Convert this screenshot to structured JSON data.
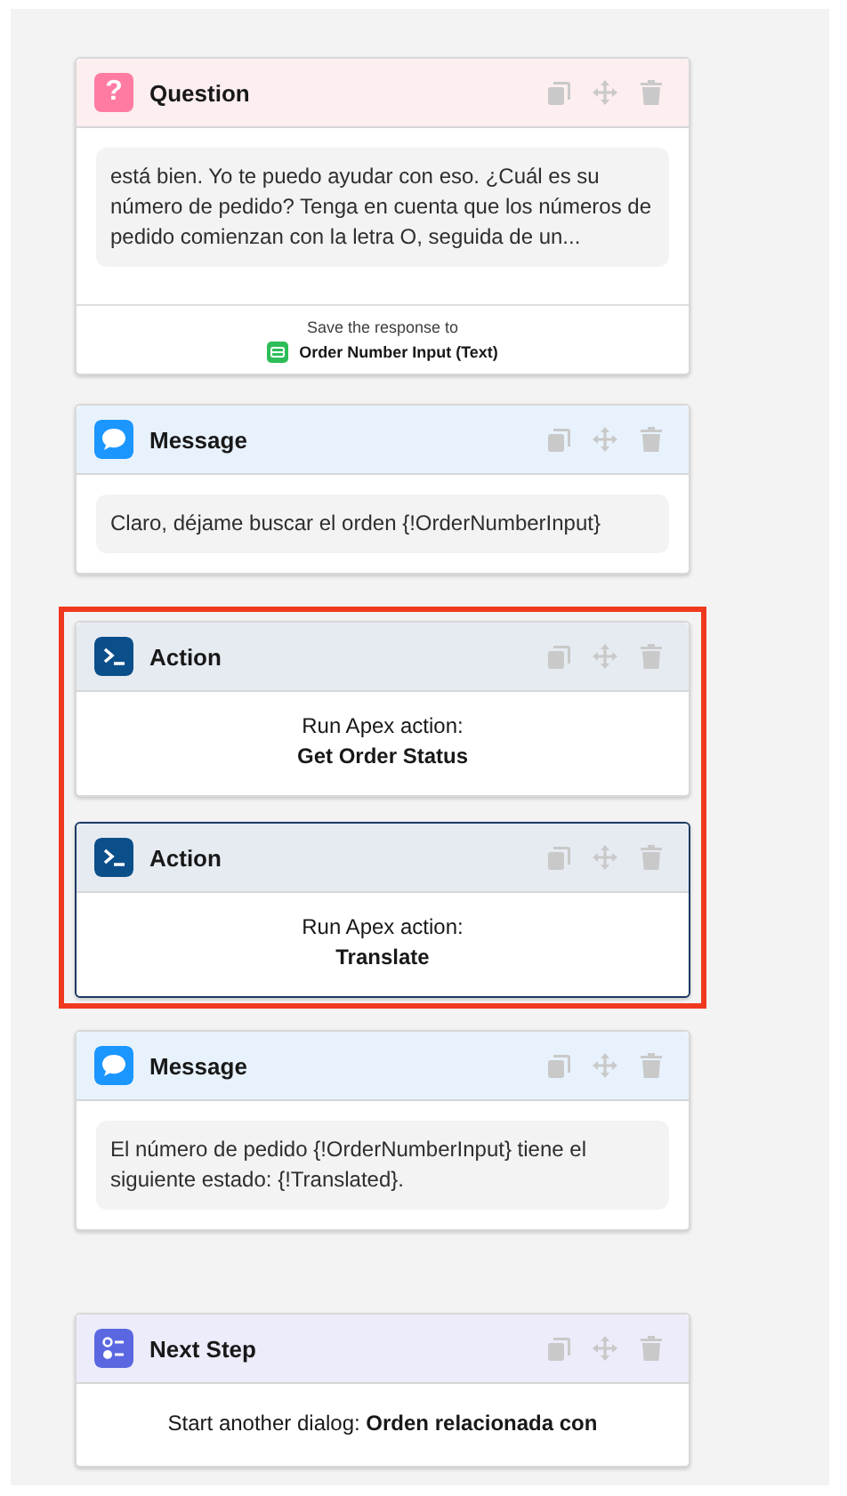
{
  "steps": [
    {
      "kind": "question",
      "title": "Question",
      "icon_text": "?",
      "highlighted": false,
      "selected": false,
      "text": "está bien. Yo te puedo ayudar con eso. ¿Cuál es su número de pedido? Tenga en cuenta que los números de pedido comienzan con la letra O, seguida de un...",
      "save_label": "Save the response to",
      "save_variable": "Order Number Input (Text)"
    },
    {
      "kind": "message",
      "title": "Message",
      "highlighted": false,
      "selected": false,
      "text": "Claro, déjame buscar el orden {!OrderNumberInput}"
    },
    {
      "kind": "action",
      "title": "Action",
      "highlighted": true,
      "selected": false,
      "caption": "Run Apex action:",
      "action_name": "Get Order Status"
    },
    {
      "kind": "action",
      "title": "Action",
      "highlighted": true,
      "selected": true,
      "caption": "Run Apex action:",
      "action_name": "Translate"
    },
    {
      "kind": "message",
      "title": "Message",
      "highlighted": false,
      "selected": false,
      "text": "El número de pedido {!OrderNumberInput} tiene el siguiente estado: {!Translated}."
    },
    {
      "kind": "next_step",
      "title": "Next Step",
      "highlighted": false,
      "selected": false,
      "text": "Start another dialog: **Orden relacionada con**"
    }
  ]
}
